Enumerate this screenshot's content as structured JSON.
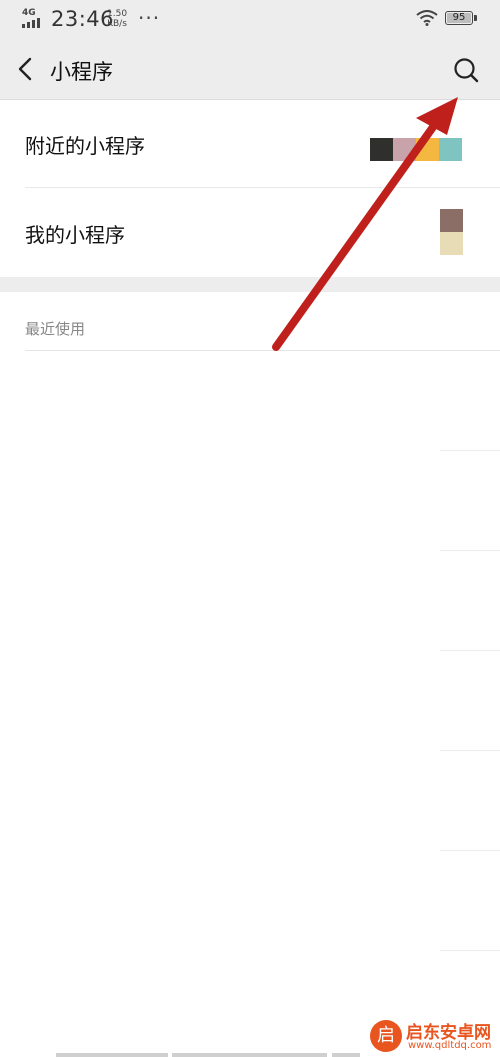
{
  "status_bar": {
    "network": "4G",
    "time": "23:46",
    "speed_value": "1.50",
    "speed_unit": "KB/s",
    "more": "···",
    "battery": "95"
  },
  "navbar": {
    "title": "小程序"
  },
  "menu": {
    "items": [
      {
        "label": "附近的小程序"
      },
      {
        "label": "我的小程序"
      }
    ]
  },
  "recent": {
    "header": "最近使用"
  },
  "thumbnails": {
    "nearby_colors": [
      "#2f302b",
      "#c9a3aa",
      "#f4b840",
      "#7fc4c0"
    ],
    "mine_colors": [
      "#8b6e66",
      "#e7dcb5"
    ]
  },
  "annotation": {
    "arrow_color": "#c0201c"
  },
  "watermark": {
    "logo_glyph": "启",
    "name": "启东安卓网",
    "url": "www.qdltdq.com"
  }
}
